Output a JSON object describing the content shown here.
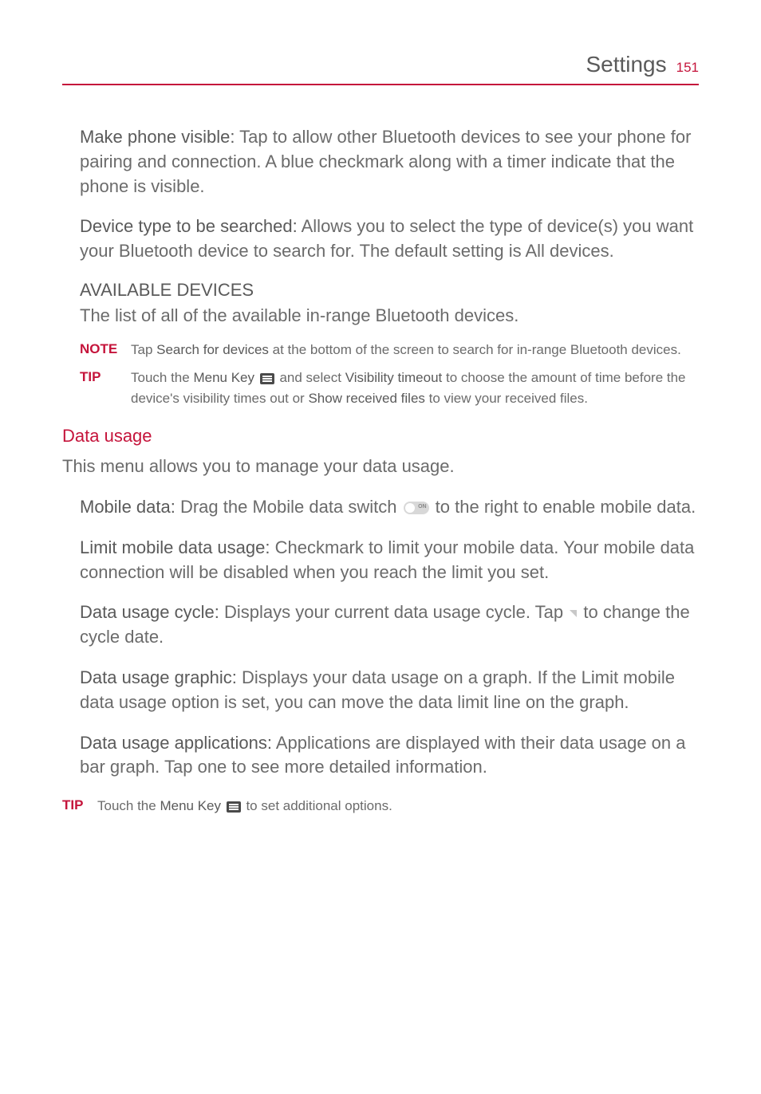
{
  "header": {
    "title": "Settings",
    "page": "151"
  },
  "p1": {
    "label": "Make phone visible:",
    "text": " Tap to allow other Bluetooth devices to see your phone for pairing and connection. A blue checkmark along with a timer indicate that the phone is visible."
  },
  "p2": {
    "label": "Device type to be searched:",
    "text": " Allows you to select the type of device(s) you want your Bluetooth device to search for. The default setting is All devices."
  },
  "available_heading": "AVAILABLE DEVICES",
  "available_text": "The list of all of the available in-range Bluetooth devices.",
  "note": {
    "label": "NOTE",
    "pre": "Tap ",
    "strong": "Search for devices",
    "post": " at the bottom of the screen to search for in-range Bluetooth devices."
  },
  "tip1": {
    "label": "TIP",
    "pre": "Touch the ",
    "strong1": "Menu Key",
    "mid1": " and select ",
    "strong2": "Visibility timeout",
    "mid2": " to choose the amount of time before the device's visibility times out or ",
    "strong3": "Show received files",
    "post": " to view your received files."
  },
  "data_usage_heading": "Data usage",
  "data_usage_intro": "This menu allows you to manage your data usage.",
  "mobile_data": {
    "label": "Mobile data:",
    "pre": " Drag the Mobile data switch ",
    "post": " to the right to enable mobile data."
  },
  "limit": {
    "label": "Limit mobile data usage:",
    "text": " Checkmark to limit your mobile data. Your mobile data connection will be disabled when you reach the limit you set."
  },
  "cycle": {
    "label": "Data usage cycle:",
    "pre": " Displays your current data usage cycle. Tap ",
    "post": " to change the cycle date."
  },
  "graphic": {
    "label": "Data usage graphic:",
    "text": " Displays your data usage on a graph. If the Limit mobile data usage option is set, you can move the data limit line on the graph."
  },
  "applications": {
    "label": "Data usage applications:",
    "text": " Applications are displayed with their data usage on a bar graph. Tap one to see more detailed information."
  },
  "tip2": {
    "label": "TIP",
    "pre": "Touch the ",
    "strong": "Menu Key",
    "post": "  to set additional options."
  }
}
